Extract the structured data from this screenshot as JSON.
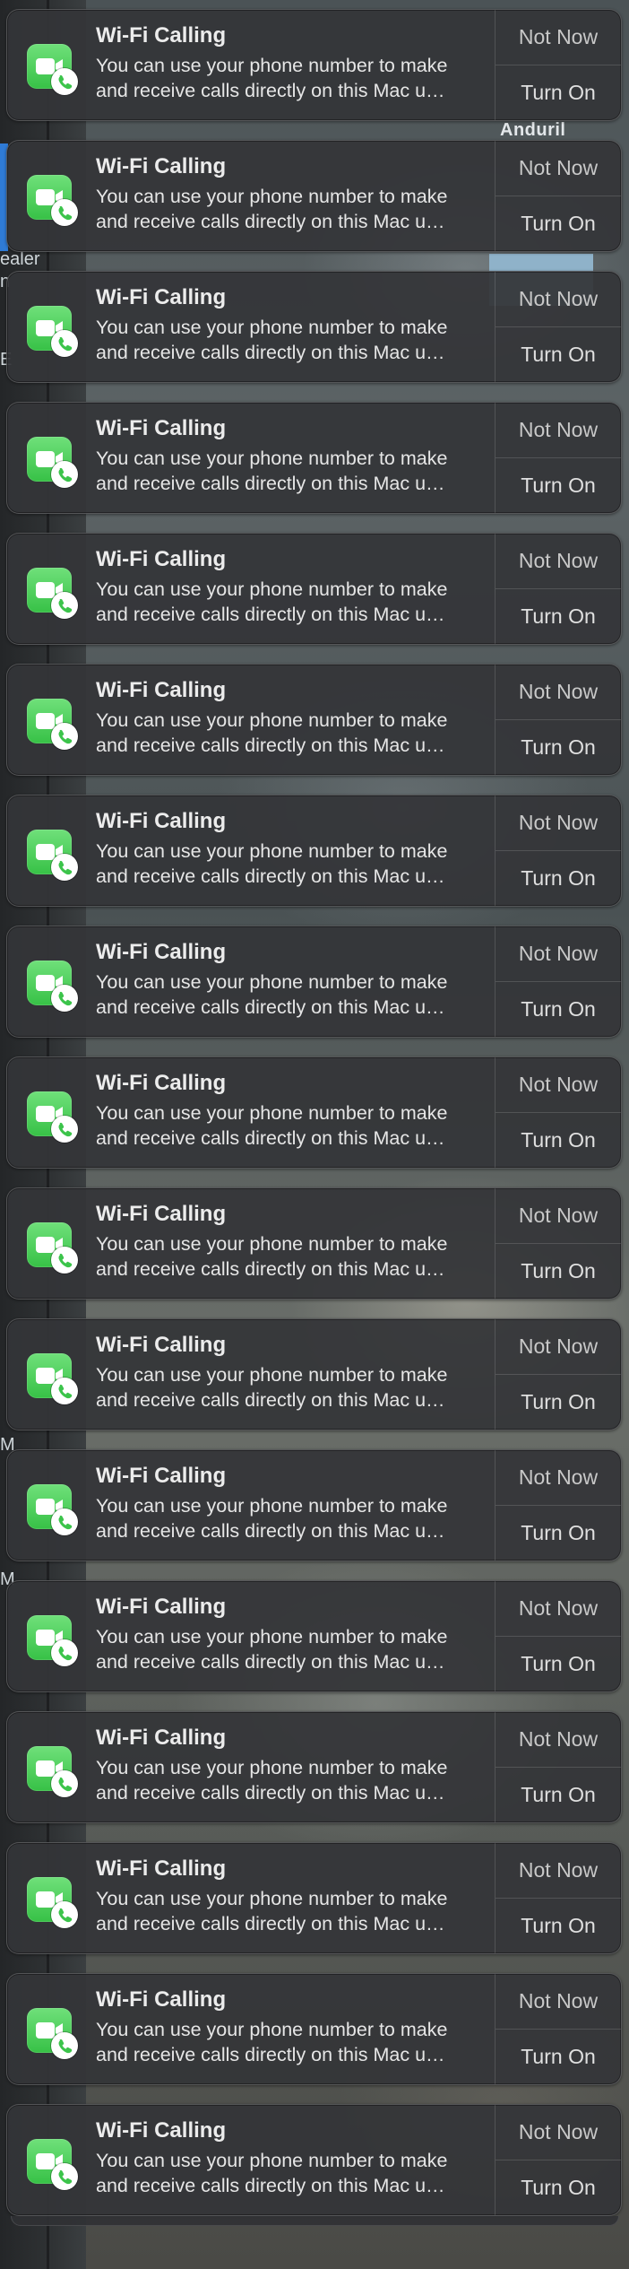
{
  "desktop": {
    "background_label": "Anduril",
    "sidebar_fragments": [
      "ealer",
      "n",
      "E",
      "M",
      "M"
    ]
  },
  "notification_template": {
    "app_icon": "facetime-phone-icon",
    "accent_color": "#37c146"
  },
  "notifications": [
    {
      "title": "Wi-Fi Calling",
      "body_line1": "You can use your phone number to make",
      "body_line2": "and receive calls directly on this Mac u…",
      "primary_action": "Not Now",
      "secondary_action": "Turn On"
    },
    {
      "title": "Wi-Fi Calling",
      "body_line1": "You can use your phone number to make",
      "body_line2": "and receive calls directly on this Mac u…",
      "primary_action": "Not Now",
      "secondary_action": "Turn On"
    },
    {
      "title": "Wi-Fi Calling",
      "body_line1": "You can use your phone number to make",
      "body_line2": "and receive calls directly on this Mac u…",
      "primary_action": "Not Now",
      "secondary_action": "Turn On"
    },
    {
      "title": "Wi-Fi Calling",
      "body_line1": "You can use your phone number to make",
      "body_line2": "and receive calls directly on this Mac u…",
      "primary_action": "Not Now",
      "secondary_action": "Turn On"
    },
    {
      "title": "Wi-Fi Calling",
      "body_line1": "You can use your phone number to make",
      "body_line2": "and receive calls directly on this Mac u…",
      "primary_action": "Not Now",
      "secondary_action": "Turn On"
    },
    {
      "title": "Wi-Fi Calling",
      "body_line1": "You can use your phone number to make",
      "body_line2": "and receive calls directly on this Mac u…",
      "primary_action": "Not Now",
      "secondary_action": "Turn On"
    },
    {
      "title": "Wi-Fi Calling",
      "body_line1": "You can use your phone number to make",
      "body_line2": "and receive calls directly on this Mac u…",
      "primary_action": "Not Now",
      "secondary_action": "Turn On"
    },
    {
      "title": "Wi-Fi Calling",
      "body_line1": "You can use your phone number to make",
      "body_line2": "and receive calls directly on this Mac u…",
      "primary_action": "Not Now",
      "secondary_action": "Turn On"
    },
    {
      "title": "Wi-Fi Calling",
      "body_line1": "You can use your phone number to make",
      "body_line2": "and receive calls directly on this Mac u…",
      "primary_action": "Not Now",
      "secondary_action": "Turn On"
    },
    {
      "title": "Wi-Fi Calling",
      "body_line1": "You can use your phone number to make",
      "body_line2": "and receive calls directly on this Mac u…",
      "primary_action": "Not Now",
      "secondary_action": "Turn On"
    },
    {
      "title": "Wi-Fi Calling",
      "body_line1": "You can use your phone number to make",
      "body_line2": "and receive calls directly on this Mac u…",
      "primary_action": "Not Now",
      "secondary_action": "Turn On"
    },
    {
      "title": "Wi-Fi Calling",
      "body_line1": "You can use your phone number to make",
      "body_line2": "and receive calls directly on this Mac u…",
      "primary_action": "Not Now",
      "secondary_action": "Turn On"
    },
    {
      "title": "Wi-Fi Calling",
      "body_line1": "You can use your phone number to make",
      "body_line2": "and receive calls directly on this Mac u…",
      "primary_action": "Not Now",
      "secondary_action": "Turn On"
    },
    {
      "title": "Wi-Fi Calling",
      "body_line1": "You can use your phone number to make",
      "body_line2": "and receive calls directly on this Mac u…",
      "primary_action": "Not Now",
      "secondary_action": "Turn On"
    },
    {
      "title": "Wi-Fi Calling",
      "body_line1": "You can use your phone number to make",
      "body_line2": "and receive calls directly on this Mac u…",
      "primary_action": "Not Now",
      "secondary_action": "Turn On"
    },
    {
      "title": "Wi-Fi Calling",
      "body_line1": "You can use your phone number to make",
      "body_line2": "and receive calls directly on this Mac u…",
      "primary_action": "Not Now",
      "secondary_action": "Turn On"
    },
    {
      "title": "Wi-Fi Calling",
      "body_line1": "You can use your phone number to make",
      "body_line2": "and receive calls directly on this Mac u…",
      "primary_action": "Not Now",
      "secondary_action": "Turn On"
    }
  ]
}
